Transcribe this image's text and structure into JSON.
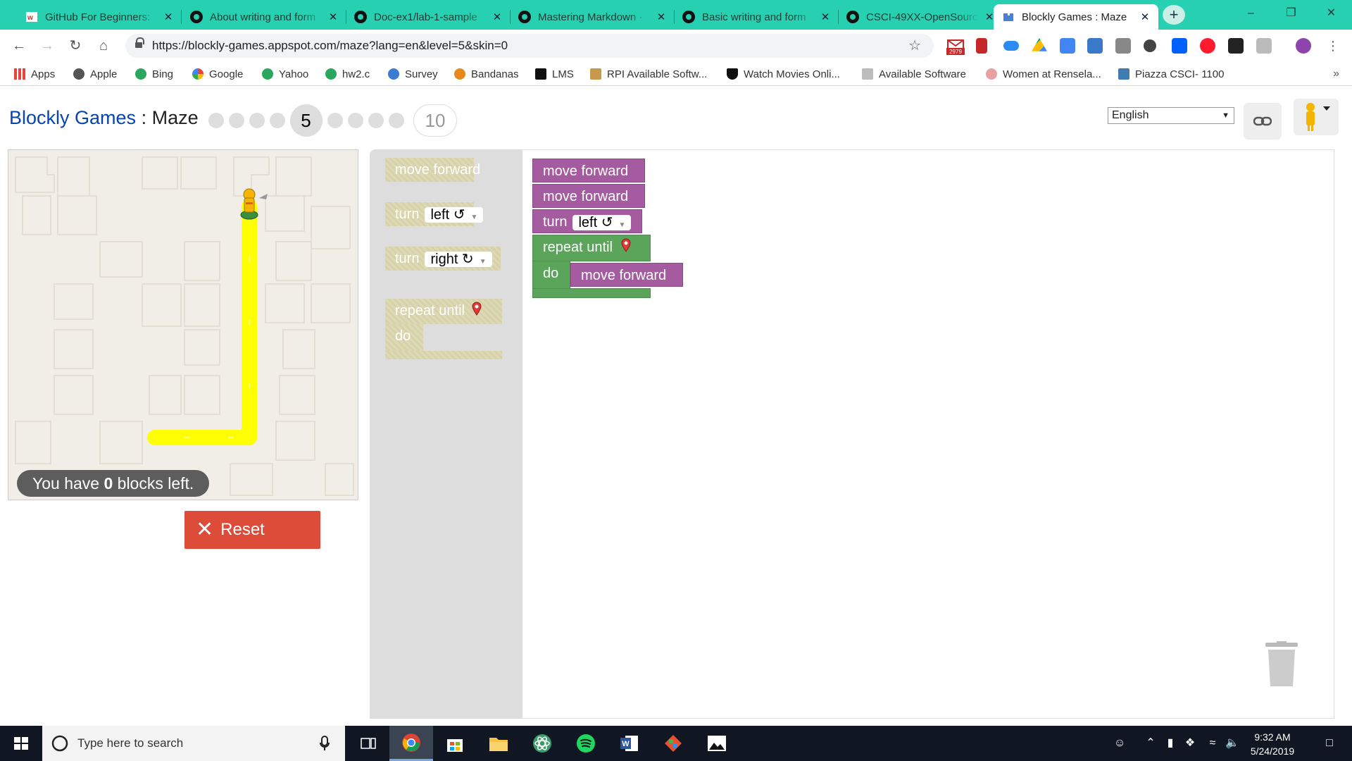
{
  "browser": {
    "tabs": [
      {
        "title": "GitHub For Beginners:",
        "icon": "w-icon",
        "active": false
      },
      {
        "title": "About writing and form",
        "icon": "github-icon",
        "active": false
      },
      {
        "title": "Doc-ex1/lab-1-sample",
        "icon": "github-icon",
        "active": false
      },
      {
        "title": "Mastering Markdown ·",
        "icon": "github-icon",
        "active": false
      },
      {
        "title": "Basic writing and form",
        "icon": "github-icon",
        "active": false
      },
      {
        "title": "CSCI-49XX-OpenSourc",
        "icon": "github-icon",
        "active": false
      },
      {
        "title": "Blockly Games : Maze",
        "icon": "blockly-icon",
        "active": true
      }
    ],
    "close_glyph": "✕",
    "new_tab_glyph": "+",
    "window": {
      "minimize": "–",
      "restore": "❐",
      "close": "✕"
    },
    "url": "https://blockly-games.appspot.com/maze?lang=en&level=5&skin=0",
    "gmail_badge": "2979",
    "bookmarks": [
      {
        "label": "Apps"
      },
      {
        "label": "Apple"
      },
      {
        "label": "Bing"
      },
      {
        "label": "Google"
      },
      {
        "label": "Yahoo"
      },
      {
        "label": "hw2.c"
      },
      {
        "label": "Survey"
      },
      {
        "label": "Bandanas"
      },
      {
        "label": "LMS"
      },
      {
        "label": "RPI Available Softw..."
      },
      {
        "label": "Watch Movies Onli..."
      },
      {
        "label": "Available Software"
      },
      {
        "label": "Women at Rensela..."
      },
      {
        "label": "Piazza CSCI- 1100"
      }
    ],
    "bookmarks_more": "»"
  },
  "game": {
    "title_link": "Blockly Games",
    "title_sep": " : ",
    "title_page": "Maze",
    "current_level": "5",
    "last_level": "10",
    "language": "English",
    "blocks_left_prefix": "You have ",
    "blocks_left_count": "0",
    "blocks_left_suffix": " blocks left.",
    "reset_label": "Reset",
    "toolbox": {
      "move_forward": "move forward",
      "turn": "turn",
      "left": "left ↺",
      "right": "right ↻",
      "repeat_until": "repeat until",
      "do": "do"
    },
    "program": {
      "line1": "move forward",
      "line2": "move forward",
      "line3_turn": "turn",
      "line3_dir": "left ↺",
      "repeat_until": "repeat until",
      "do": "do",
      "inner": "move forward"
    }
  },
  "taskbar": {
    "search_placeholder": "Type here to search",
    "time": "9:32 AM",
    "date": "5/24/2019"
  },
  "colors": {
    "tab_strip": "#26d0b1",
    "reset": "#dd4b39",
    "block_purple": "#a55b9f",
    "block_green": "#5ba55b",
    "path_yellow": "#ffff00"
  }
}
